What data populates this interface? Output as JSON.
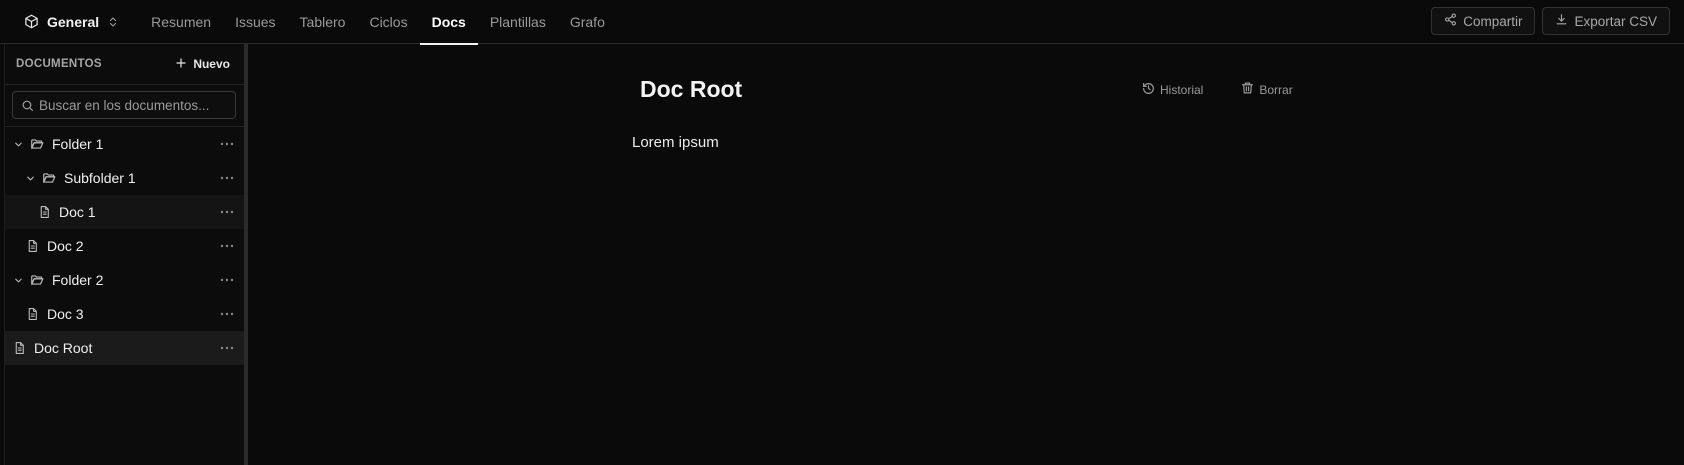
{
  "project": {
    "name": "General",
    "icon": "cube-icon"
  },
  "nav": {
    "tabs": [
      {
        "label": "Resumen",
        "active": false
      },
      {
        "label": "Issues",
        "active": false
      },
      {
        "label": "Tablero",
        "active": false
      },
      {
        "label": "Ciclos",
        "active": false
      },
      {
        "label": "Docs",
        "active": true
      },
      {
        "label": "Plantillas",
        "active": false
      },
      {
        "label": "Grafo",
        "active": false
      }
    ]
  },
  "actions": {
    "share_label": "Compartir",
    "export_label": "Exportar CSV"
  },
  "sidebar": {
    "title": "DOCUMENTOS",
    "new_label": "Nuevo",
    "search_placeholder": "Buscar en los documentos...",
    "tree": [
      {
        "label": "Folder 1",
        "type": "folder",
        "expanded": true
      },
      {
        "label": "Subfolder 1",
        "type": "folder",
        "expanded": true
      },
      {
        "label": "Doc 1",
        "type": "doc"
      },
      {
        "label": "Doc 2",
        "type": "doc"
      },
      {
        "label": "Folder 2",
        "type": "folder",
        "expanded": true
      },
      {
        "label": "Doc 3",
        "type": "doc"
      },
      {
        "label": "Doc Root",
        "type": "doc",
        "selected": true
      }
    ]
  },
  "document": {
    "title": "Doc Root",
    "history_label": "Historial",
    "delete_label": "Borrar",
    "body": "Lorem ipsum"
  },
  "colors": {
    "background": "#0a0a0a",
    "border": "#2a2a2a",
    "text": "#f0f0f0",
    "muted": "#9a9a9a"
  }
}
